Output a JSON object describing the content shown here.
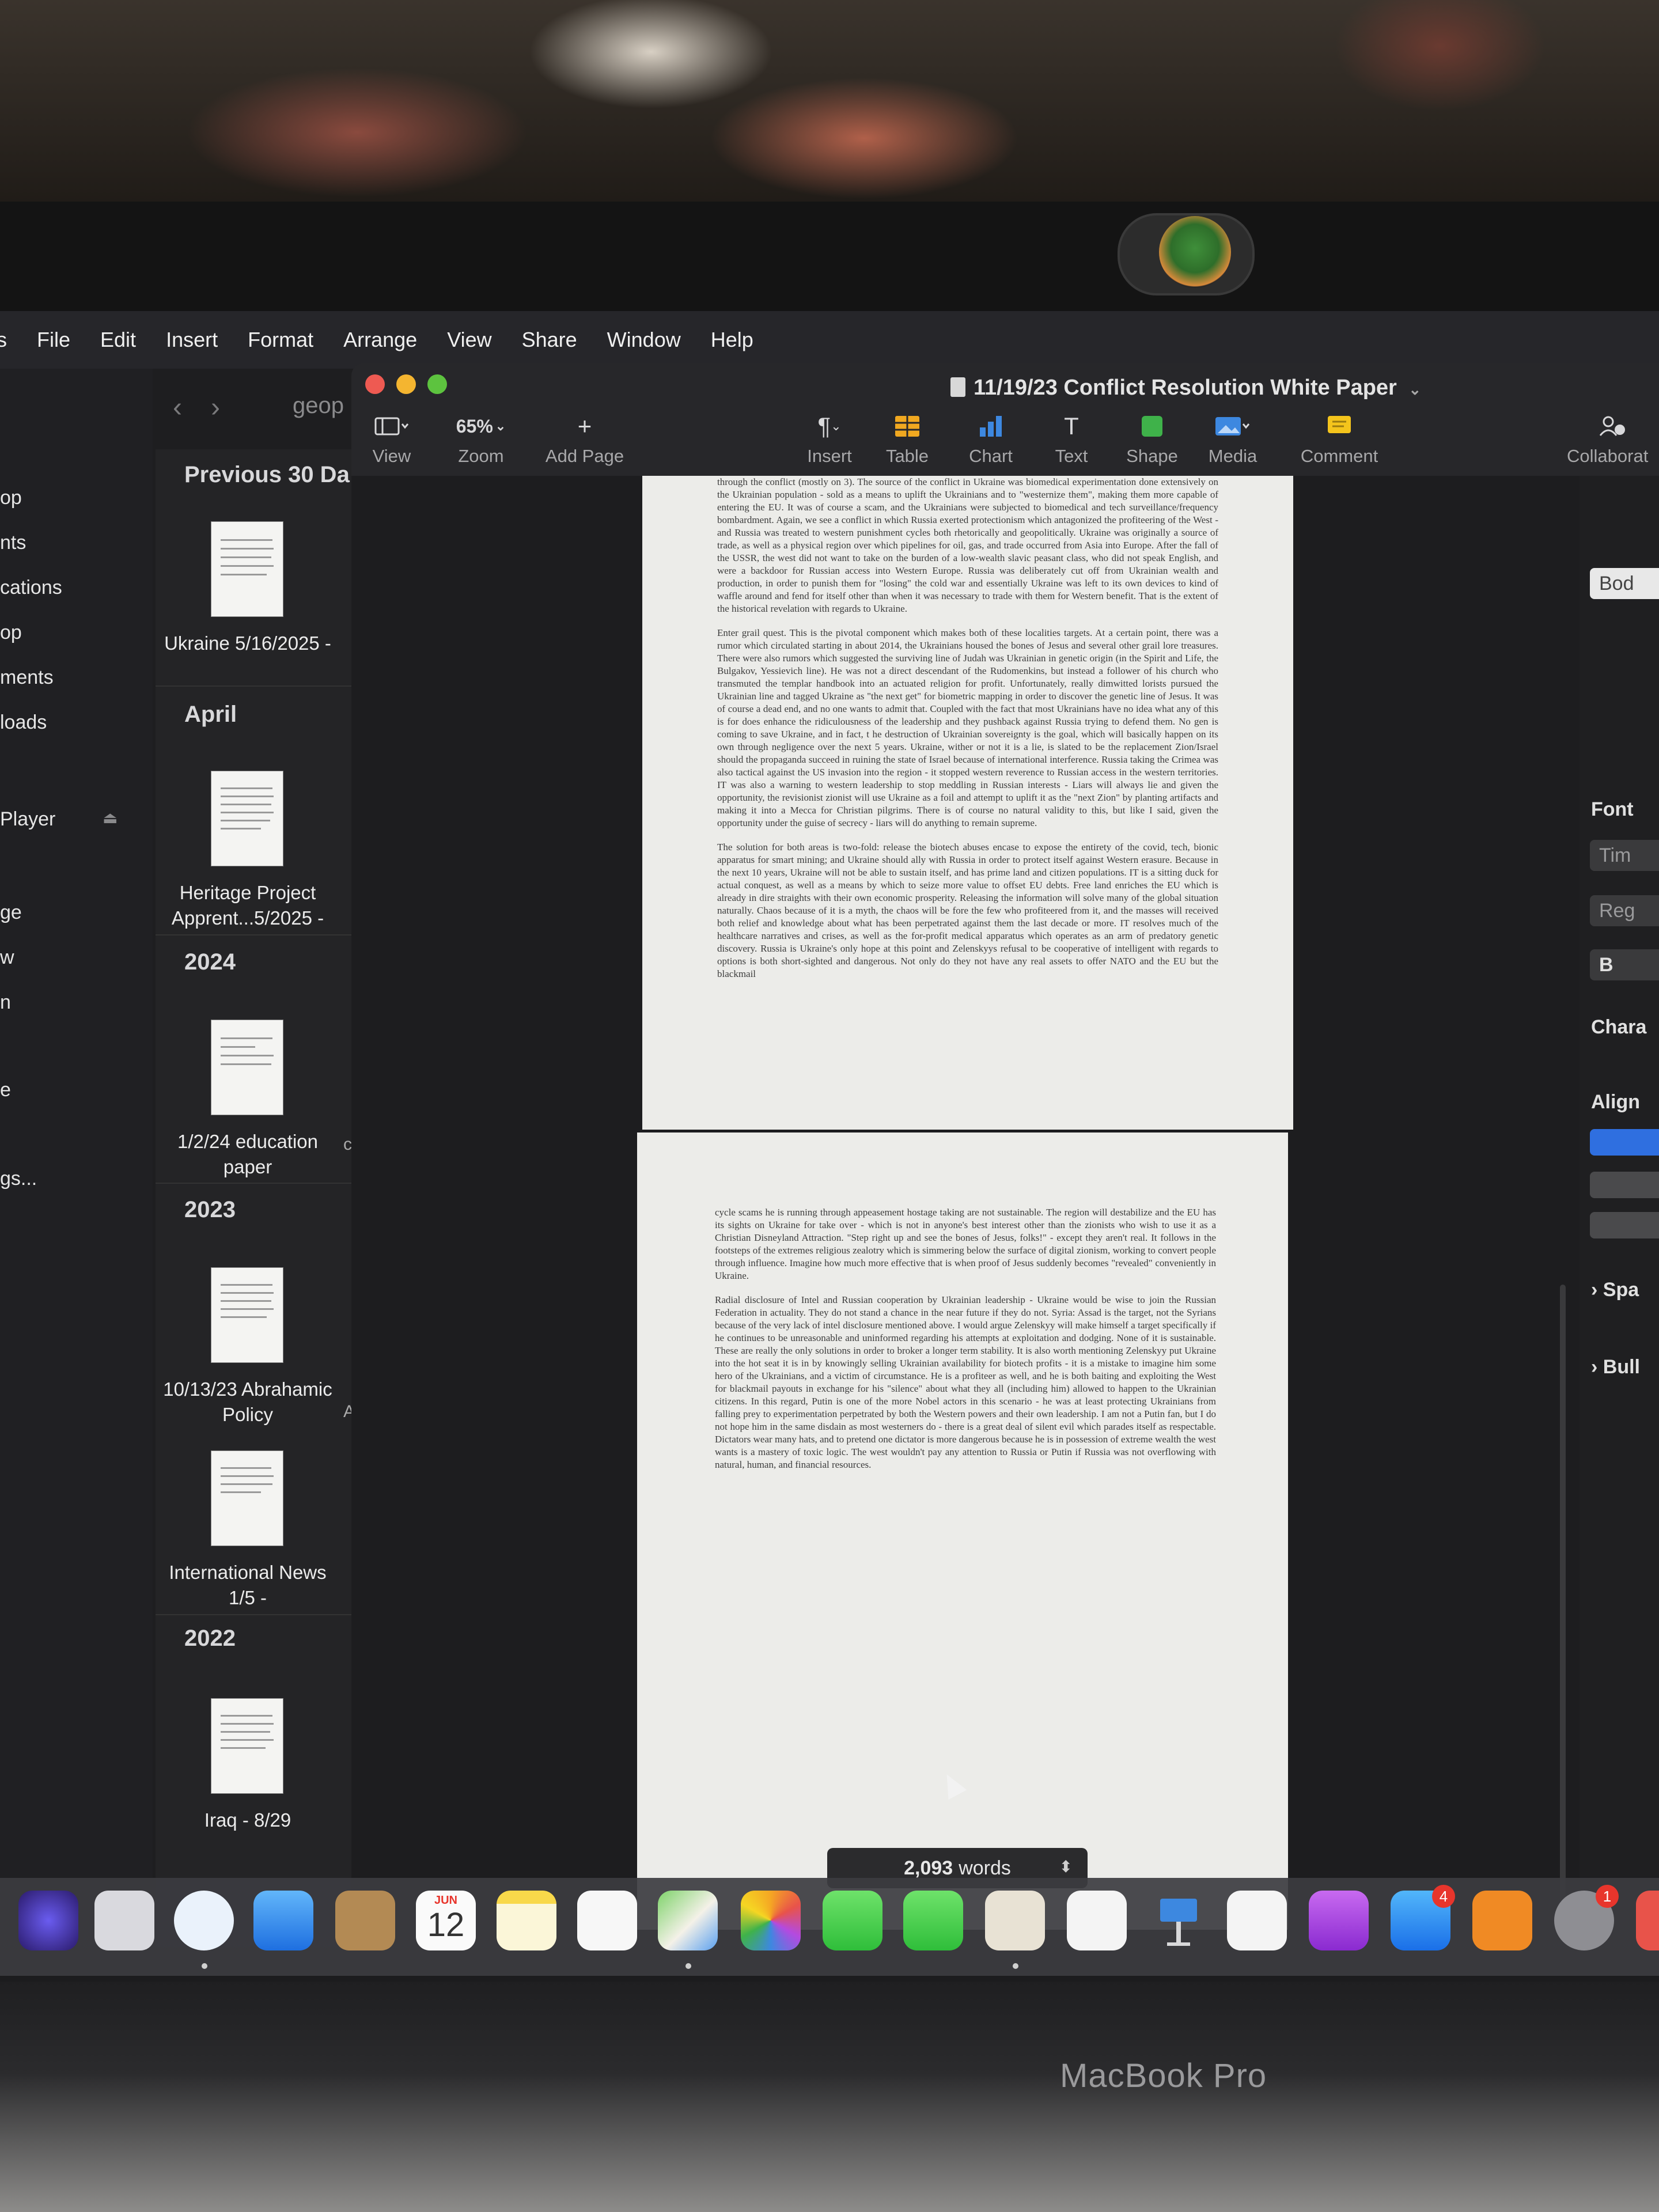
{
  "menubar": {
    "items": [
      "s",
      "File",
      "Edit",
      "Insert",
      "Format",
      "Arrange",
      "View",
      "Share",
      "Window",
      "Help"
    ]
  },
  "browser": {
    "path_partial": "geop",
    "sidebar_items": [
      "op",
      "nts",
      "cations",
      "op",
      "ments",
      "loads",
      "Player",
      "ge",
      "w",
      "n",
      "e",
      "gs..."
    ],
    "sections": {
      "previous30": "Previous 30 Da",
      "april": "April",
      "y2024": "2024",
      "y2023": "2023",
      "y2022": "2022"
    },
    "docs": [
      "Ukraine 5/16/2025 -",
      "Heritage Project Apprent...5/2025 -",
      "1/2/24 education paper",
      "10/13/23 Abrahamic Policy",
      "International News 1/5 -",
      "Iraq - 8/29"
    ],
    "doc_extras": [
      "c",
      "A"
    ]
  },
  "window": {
    "title": "11/19/23  Conflict Resolution White Paper",
    "toolbar": {
      "view": "View",
      "zoom_value": "65%",
      "zoom": "Zoom",
      "add_page": "Add Page",
      "insert": "Insert",
      "table": "Table",
      "chart": "Chart",
      "text": "Text",
      "shape": "Shape",
      "media": "Media",
      "comment": "Comment",
      "collaborate": "Collaborat"
    }
  },
  "document": {
    "page1": [
      "through the conflict (mostly on 3). The source of the conflict in Ukraine was biomedical experimentation done extensively on the Ukrainian population - sold as a means to uplift the Ukrainians and to \"westernize them\", making them more capable of entering the EU. It was of course a scam, and the Ukrainians were subjected to biomedical and tech surveillance/frequency bombardment. Again, we see a conflict in which Russia exerted protectionism which antagonized the profiteering of the West - and Russia was treated to western punishment cycles both rhetorically and geopolitically. Ukraine was originally a source of trade, as well as a physical region over which pipelines for oil, gas, and trade occurred from Asia into Europe. After the fall of the USSR, the west did not want to take on the burden of a low-wealth slavic peasant class, who did not speak English, and were a backdoor for Russian access into Western Europe. Russia was deliberately cut off from Ukrainian wealth and production, in order to punish them for \"losing\" the cold war and essentially Ukraine was left to its own devices to kind of waffle around and fend for itself other than when it was necessary to trade with them for Western benefit. That is the extent of the historical revelation with regards to Ukraine.",
      "Enter grail quest. This is the pivotal component which makes both of these localities targets. At a certain point, there was a rumor which circulated starting in about 2014, the Ukrainians housed the bones of Jesus and several other grail lore treasures. There were also rumors which suggested the surviving line of Judah was Ukrainian in genetic origin (in the Spirit and Life, the Bulgakov, Yessievich line). He was not a direct descendant of the Rudomenkins, but instead a follower of his church who transmuted the templar handbook into an actuated religion for profit. Unfortunately, really dimwitted lorists pursued the Ukrainian line and tagged Ukraine as \"the next get\" for biometric mapping in order to discover the genetic line of Jesus. It was of course a dead end, and no one wants to admit that. Coupled with the fact that most Ukrainians have no idea what any of this is for does enhance the ridiculousness of the leadership and they pushback against Russia trying to defend them. No gen is coming to save Ukraine, and in fact, t he destruction of Ukrainian sovereignty is the goal, which will basically happen on its own through negligence over the next 5 years. Ukraine, wither or not it is a lie, is slated to be the replacement Zion/Israel should the  propaganda succeed in ruining the state of Israel because of international interference. Russia taking the Crimea was also tactical against the US invasion into the region - it stopped western reverence to Russian access in the western territories. IT was also a warning to western leadership to stop meddling in Russian interests - Liars will always lie and given the opportunity, the revisionist zionist will use Ukraine as a foil and attempt to uplift it as the \"next Zion\" by planting artifacts and making it into a Mecca for Christian pilgrims. There is of course no natural validity to this, but like I said, given the opportunity under the guise of secrecy - liars will do anything to remain supreme.",
      "The solution for both areas is two-fold: release the biotech abuses encase to expose the entirety of the covid, tech, bionic apparatus for smart mining; and Ukraine should ally with Russia in order to protect itself against Western erasure. Because in the next 10 years, Ukraine will not be able to sustain itself, and has prime land and citizen populations. IT is a sitting duck for actual conquest, as well as a means by which to seize more value to offset EU debts. Free land enriches the EU which is already in dire straights with their own economic prosperity. Releasing the information will solve many of the global situation naturally. Chaos because of it is a myth, the chaos will be fore the few who profiteered from it, and the masses will received both relief and knowledge about what has been perpetrated against them the last decade or more. IT resolves much of the healthcare narratives and crises, as well as the for-profit medical apparatus which operates as an arm of predatory genetic discovery. Russia is Ukraine's only hope at this point and Zelenskyys refusal to be cooperative of intelligent with regards to options is both short-sighted and dangerous. Not only do they not have any real assets to offer NATO and the EU but the blackmail"
    ],
    "page2": [
      "cycle scams he is running through appeasement hostage taking are not sustainable. The region will destabilize and the EU has its sights on Ukraine for take over - which is not in anyone's best interest other than the zionists who wish to use it as a Christian Disneyland Attraction. \"Step right up and see the bones of Jesus, folks!\" - except they aren't real. It follows in the footsteps of the extremes religious zealotry which is simmering below the surface of digital zionism, working to convert people through influence. Imagine how much more effective that is when proof of Jesus suddenly becomes \"revealed\" conveniently in Ukraine.",
      "Radial disclosure of Intel and Russian cooperation by Ukrainian leadership - Ukraine would be wise to join the Russian Federation in actuality. They do not stand a chance in the near future if they do not. Syria: Assad is the target, not the Syrians because of the very lack of intel disclosure mentioned above. I would argue Zelenskyy will make himself a target specifically if he continues to be unreasonable and uninformed regarding his attempts at exploitation and dodging. None of it is sustainable. These are really the only solutions in order to broker a longer term stability. It is also worth mentioning Zelenskyy put Ukraine into the hot seat it is in by knowingly selling Ukrainian availability for biotech profits - it is a mistake to imagine him some hero of the Ukrainians, and a victim of circumstance. He is a profiteer as well, and he is both baiting and exploiting the West for blackmail payouts in exchange for his \"silence\" about what they all (including him) allowed to happen to the Ukrainian citizens. In this regard, Putin is one of the more Nobel actors in this scenario - he was at least protecting Ukrainians from falling prey to experimentation perpetrated by both the Western powers and their own leadership. I am not a Putin fan, but I do not hope him in the same disdain as most westerners do - there is a great deal of silent evil which parades itself as respectable. Dictators wear many hats, and to pretend one dictator is more dangerous because he is in possession of extreme wealth the west wants is a mastery of toxic logic. The west wouldn't pay any attention to Russia or Putin if Russia was not overflowing with natural, human, and financial resources."
    ]
  },
  "status": {
    "word_count": "2,093",
    "words_label": "words"
  },
  "inspector": {
    "style_partial": "Bod",
    "font_label": "Font",
    "font_name": "Tim",
    "font_style": "Reg",
    "bold": "B",
    "char_label": "Chara",
    "align_label": "Align",
    "spacing_label": "Spa",
    "bullets_label": "Bull"
  },
  "dock": {
    "calendar_month": "JUN",
    "calendar_day": "12",
    "appstore_badge": "4",
    "settings_badge": "1"
  },
  "hardware": {
    "label": "MacBook Pro"
  }
}
